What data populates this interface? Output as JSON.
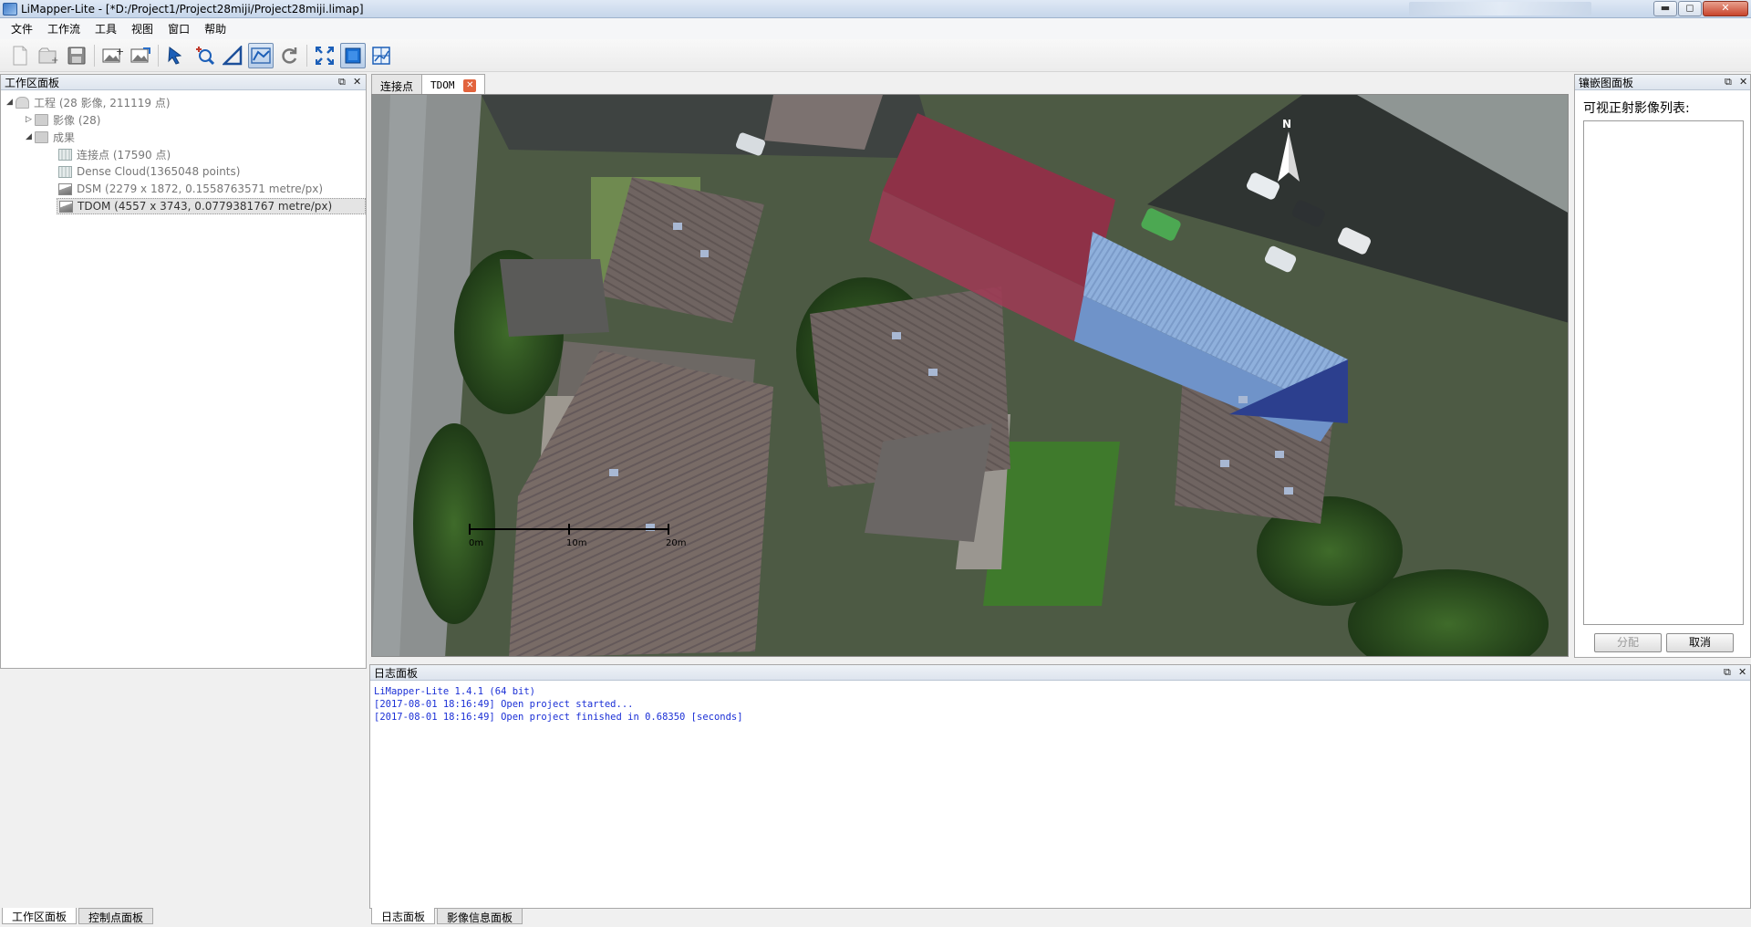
{
  "window": {
    "title": "LiMapper-Lite - [*D:/Project1/Project28miji/Project28miji.limap]",
    "minimize": "▬",
    "maximize": "◻",
    "close": "✕"
  },
  "menu": [
    "文件",
    "工作流",
    "工具",
    "视图",
    "窗口",
    "帮助"
  ],
  "toolbar": {
    "icons": [
      "new-file-icon",
      "new-project-icon",
      "save-icon",
      "add-image-icon",
      "export-image-icon",
      "select-arrow-icon",
      "zoom-in-icon",
      "measure-triangle-icon",
      "edit-polygon-icon",
      "refresh-icon",
      "fit-extent-icon",
      "layer-view-icon",
      "orthophoto-icon"
    ]
  },
  "workspace": {
    "title": "工作区面板",
    "float_symbol": "⧉",
    "close_symbol": "✕",
    "tree": {
      "project": "工程 (28 影像, 211119 点)",
      "images": "影像 (28)",
      "results": "成果",
      "tie_points": "连接点 (17590 点)",
      "dense_cloud": "Dense Cloud(1365048 points)",
      "dsm": "DSM (2279 x 1872, 0.1558763571 metre/px)",
      "tdom": "TDOM (4557 x 3743, 0.0779381767 metre/px)"
    },
    "bottom_tabs": [
      "工作区面板",
      "控制点面板"
    ]
  },
  "doc_tabs": [
    "连接点",
    "TDOM"
  ],
  "map": {
    "scale_labels": [
      "0m",
      "10m",
      "20m"
    ],
    "north_label": "N"
  },
  "mosaic": {
    "title": "镶嵌图面板",
    "list_label": "可视正射影像列表:",
    "assign_button": "分配",
    "cancel_button": "取消"
  },
  "log": {
    "title": "日志面板",
    "lines": [
      "LiMapper-Lite 1.4.1 (64 bit)",
      "[2017-08-01 18:16:49] Open project started...",
      "[2017-08-01 18:16:49] Open project finished in 0.68350 [seconds]"
    ],
    "bottom_tabs": [
      "日志面板",
      "影像信息面板"
    ]
  },
  "colors": {
    "log_text": "#1a2fd6",
    "red_roof": "#8e3147",
    "blue_roof": "#8fb0dc",
    "tab_close": "#e2633d"
  }
}
